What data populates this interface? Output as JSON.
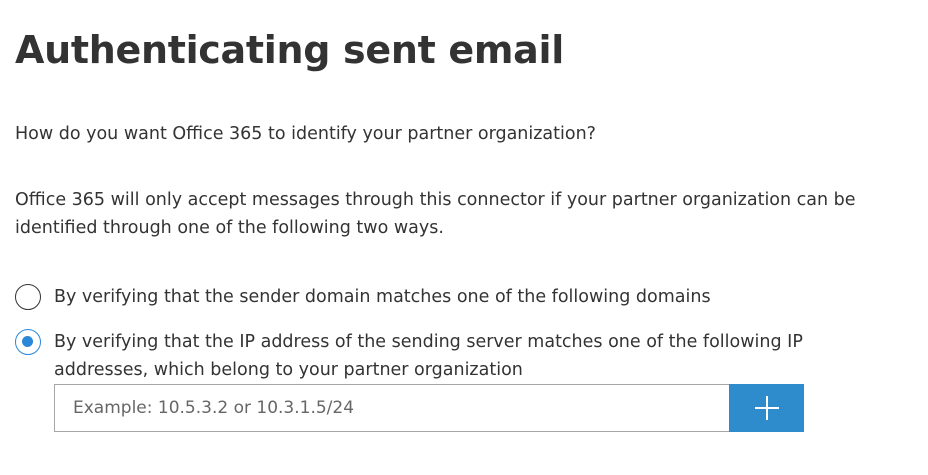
{
  "page": {
    "title": "Authenticating sent email",
    "question": "How do you want Office 365 to identify your partner organization?",
    "info": "Office 365 will only accept messages through this connector if your partner organization can be identified through one of the following two ways."
  },
  "options": [
    {
      "label": "By verifying that the sender domain matches one of the following domains",
      "selected": false
    },
    {
      "label": "By verifying that the IP address of the sending server matches one of the following IP addresses, which belong to your partner organization",
      "selected": true
    }
  ],
  "ip_input": {
    "value": "",
    "placeholder": "Example: 10.5.3.2 or 10.3.1.5/24"
  },
  "add_button": {
    "icon": "plus-icon"
  },
  "colors": {
    "accent": "#2b88d8",
    "button": "#2e8ccd",
    "text": "#333333"
  }
}
